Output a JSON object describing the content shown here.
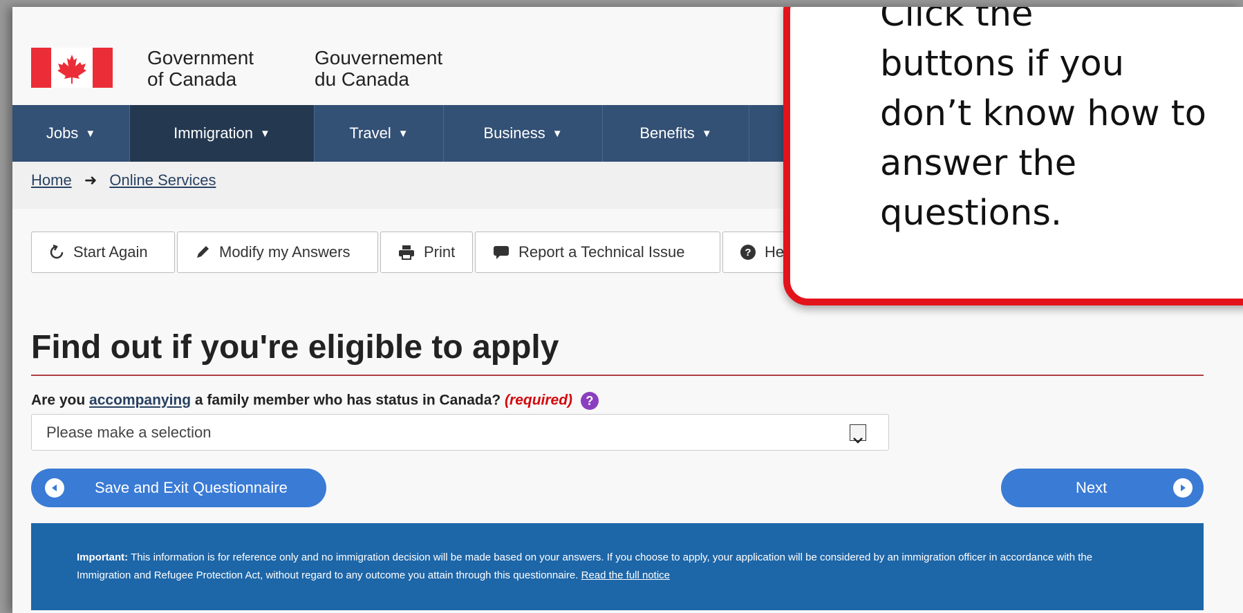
{
  "header": {
    "sig_en_line1": "Government",
    "sig_en_line2": "of Canada",
    "sig_fr_line1": "Gouvernement",
    "sig_fr_line2": "du Canada"
  },
  "nav": {
    "items": [
      {
        "label": "Jobs"
      },
      {
        "label": "Immigration"
      },
      {
        "label": "Travel"
      },
      {
        "label": "Business"
      },
      {
        "label": "Benefits"
      }
    ]
  },
  "breadcrumb": {
    "home": "Home",
    "current": "Online Services"
  },
  "toolbar": {
    "start_again": "Start Again",
    "modify": "Modify my Answers",
    "print": "Print",
    "report": "Report a Technical Issue",
    "help": "He"
  },
  "page": {
    "title": "Find out if you're eligible to apply",
    "question_prefix": "Are you ",
    "question_link": "accompanying",
    "question_suffix": " a family member who has status in Canada? ",
    "required": "(required)",
    "select_value": "Please make a selection"
  },
  "buttons": {
    "save_exit": "Save and Exit Questionnaire",
    "next": "Next"
  },
  "notice": {
    "label": "Important:",
    "text": " This information is for reference only and no immigration decision will be made based on your answers. If you choose to apply, your application will be considered by an immigration officer in accordance with the Immigration and Refugee Protection Act, without regard to any outcome you attain through this questionnaire. ",
    "link": "Read the full notice"
  },
  "callout": {
    "line1": "Click the",
    "line2": "buttons if you",
    "line3": "don’t know how to",
    "line4": "answer the",
    "line5": "questions."
  },
  "colors": {
    "nav": "#335075",
    "nav_active": "#243850",
    "button": "#3a7bd5",
    "notice": "#1d66a8",
    "callout_border": "#e3131b",
    "required": "#d3080c"
  }
}
